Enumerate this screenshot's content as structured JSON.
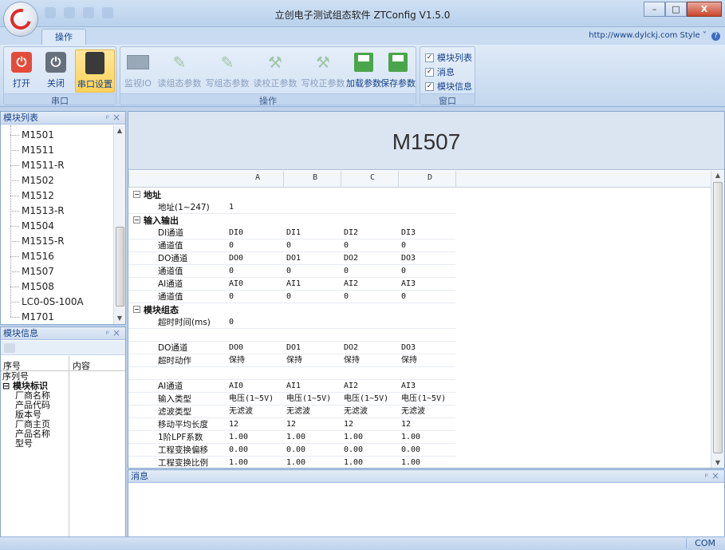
{
  "window": {
    "title": "立创电子测试组态软件 ZTConfig V1.5.0",
    "minimize": "–",
    "maximize": "□",
    "close": "X"
  },
  "ribbon": {
    "tab": "操作",
    "help_text": "http://www.dylckj.com Style",
    "help_icon": "?",
    "groups": {
      "serial": {
        "label": "串口",
        "buttons": [
          "打开",
          "关闭",
          "串口设置"
        ]
      },
      "operate": {
        "label": "操作",
        "buttons": [
          "监视IO",
          "读组态参数",
          "写组态参数",
          "读校正参数",
          "写校正参数",
          "加载参数",
          "保存参数"
        ]
      },
      "window": {
        "label": "窗口",
        "checks": [
          "模块列表",
          "消息",
          "模块信息"
        ]
      }
    }
  },
  "module_list": {
    "title": "模块列表",
    "items": [
      "M1501",
      "M1511",
      "M1511-R",
      "M1502",
      "M1512",
      "M1513-R",
      "M1504",
      "M1515-R",
      "M1516",
      "M1507",
      "M1508",
      "LC0-0S-100A",
      "M1701"
    ]
  },
  "module_info": {
    "title": "模块信息",
    "col_seq": "序号",
    "col_content": "内容",
    "rows": [
      {
        "text": "序列号",
        "kind": "plain"
      },
      {
        "text": "模块标识",
        "kind": "group"
      },
      {
        "text": "厂商名称",
        "kind": "child"
      },
      {
        "text": "产品代码",
        "kind": "child"
      },
      {
        "text": "版本号",
        "kind": "child"
      },
      {
        "text": "厂商主页",
        "kind": "child"
      },
      {
        "text": "产品名称",
        "kind": "child"
      },
      {
        "text": "型号",
        "kind": "child"
      }
    ]
  },
  "doc": {
    "title": "M1507",
    "columns": [
      "A",
      "B",
      "C",
      "D"
    ],
    "rows": [
      {
        "type": "cat",
        "label": "地址"
      },
      {
        "type": "row",
        "label": "地址(1~247)",
        "a": "1",
        "b": "",
        "c": "",
        "d": ""
      },
      {
        "type": "cat",
        "label": "输入输出"
      },
      {
        "type": "row",
        "label": "DI通道",
        "a": "DI0",
        "b": "DI1",
        "c": "DI2",
        "d": "DI3"
      },
      {
        "type": "row",
        "label": "通道值",
        "a": "0",
        "b": "0",
        "c": "0",
        "d": "0"
      },
      {
        "type": "row",
        "label": "DO通道",
        "a": "DO0",
        "b": "DO1",
        "c": "DO2",
        "d": "DO3"
      },
      {
        "type": "row",
        "label": "通道值",
        "a": "0",
        "b": "0",
        "c": "0",
        "d": "0"
      },
      {
        "type": "row",
        "label": "AI通道",
        "a": "AI0",
        "b": "AI1",
        "c": "AI2",
        "d": "AI3"
      },
      {
        "type": "row",
        "label": "通道值",
        "a": "0",
        "b": "0",
        "c": "0",
        "d": "0"
      },
      {
        "type": "cat",
        "label": "模块组态"
      },
      {
        "type": "row",
        "label": "超时时间(ms)",
        "a": "0",
        "b": "",
        "c": "",
        "d": ""
      },
      {
        "type": "row",
        "label": "",
        "a": "",
        "b": "",
        "c": "",
        "d": ""
      },
      {
        "type": "row",
        "label": "DO通道",
        "a": "DO0",
        "b": "DO1",
        "c": "DO2",
        "d": "DO3"
      },
      {
        "type": "row",
        "label": "超时动作",
        "a": "保持",
        "b": "保持",
        "c": "保持",
        "d": "保持"
      },
      {
        "type": "row",
        "label": "",
        "a": "",
        "b": "",
        "c": "",
        "d": ""
      },
      {
        "type": "row",
        "label": "AI通道",
        "a": "AI0",
        "b": "AI1",
        "c": "AI2",
        "d": "AI3"
      },
      {
        "type": "row",
        "label": "输入类型",
        "a": "电压(1~5V)",
        "b": "电压(1~5V)",
        "c": "电压(1~5V)",
        "d": "电压(1~5V)"
      },
      {
        "type": "row",
        "label": "滤波类型",
        "a": "无滤波",
        "b": "无滤波",
        "c": "无滤波",
        "d": "无滤波"
      },
      {
        "type": "row",
        "label": "移动平均长度",
        "a": "12",
        "b": "12",
        "c": "12",
        "d": "12"
      },
      {
        "type": "row",
        "label": "1阶LPF系数",
        "a": "1.00",
        "b": "1.00",
        "c": "1.00",
        "d": "1.00"
      },
      {
        "type": "row",
        "label": "工程变换偏移",
        "a": "0.00",
        "b": "0.00",
        "c": "0.00",
        "d": "0.00"
      },
      {
        "type": "row",
        "label": "工程变换比例",
        "a": "1.00",
        "b": "1.00",
        "c": "1.00",
        "d": "1.00"
      }
    ]
  },
  "messages": {
    "title": "消息"
  },
  "status": {
    "com": "COM"
  },
  "icons": {
    "pin": "pin-icon",
    "close": "close-icon",
    "collapse": "collapse-icon"
  },
  "colors": {
    "accent": "#15428b",
    "active_button": "#ffd25a",
    "ribbon_bg": "#dfeaf7",
    "close_button": "#c9452b"
  }
}
